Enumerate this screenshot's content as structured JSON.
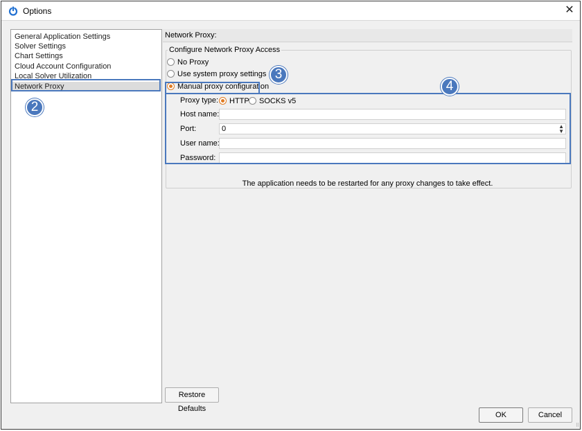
{
  "window": {
    "title": "Options",
    "close_glyph": "✕"
  },
  "sidebar": {
    "items": [
      {
        "label": "General Application Settings"
      },
      {
        "label": "Solver Settings"
      },
      {
        "label": "Chart Settings"
      },
      {
        "label": "Cloud Account Configuration"
      },
      {
        "label": "Local Solver Utilization"
      },
      {
        "label": "Network Proxy",
        "selected": true
      }
    ]
  },
  "panel": {
    "title": "Network Proxy:",
    "group_label": "Configure Network Proxy Access",
    "options": [
      {
        "label": "No Proxy",
        "checked": false
      },
      {
        "label": "Use system proxy settings",
        "checked": false
      },
      {
        "label": "Manual proxy configuration",
        "checked": true
      }
    ],
    "proxy_type_label": "Proxy type:",
    "proxy_types": [
      {
        "label": "HTTP",
        "checked": true
      },
      {
        "label": "SOCKS v5",
        "checked": false
      }
    ],
    "fields": {
      "host_label": "Host name:",
      "host_value": "",
      "port_label": "Port:",
      "port_value": "0",
      "user_label": "User name:",
      "user_value": "",
      "password_label": "Password:",
      "password_value": ""
    },
    "restart_note": "The application needs to be restarted for any proxy changes to take effect.",
    "restore_label": "Restore Defaults"
  },
  "footer": {
    "ok_label": "OK",
    "cancel_label": "Cancel"
  },
  "callouts": {
    "c2": "2",
    "c3": "3",
    "c4": "4"
  },
  "colors": {
    "highlight": "#4a78bd",
    "radio_accent": "#e07b22"
  },
  "icons": {
    "app": "power-icon",
    "close": "close-icon",
    "spin": "spinner-arrows-icon"
  }
}
